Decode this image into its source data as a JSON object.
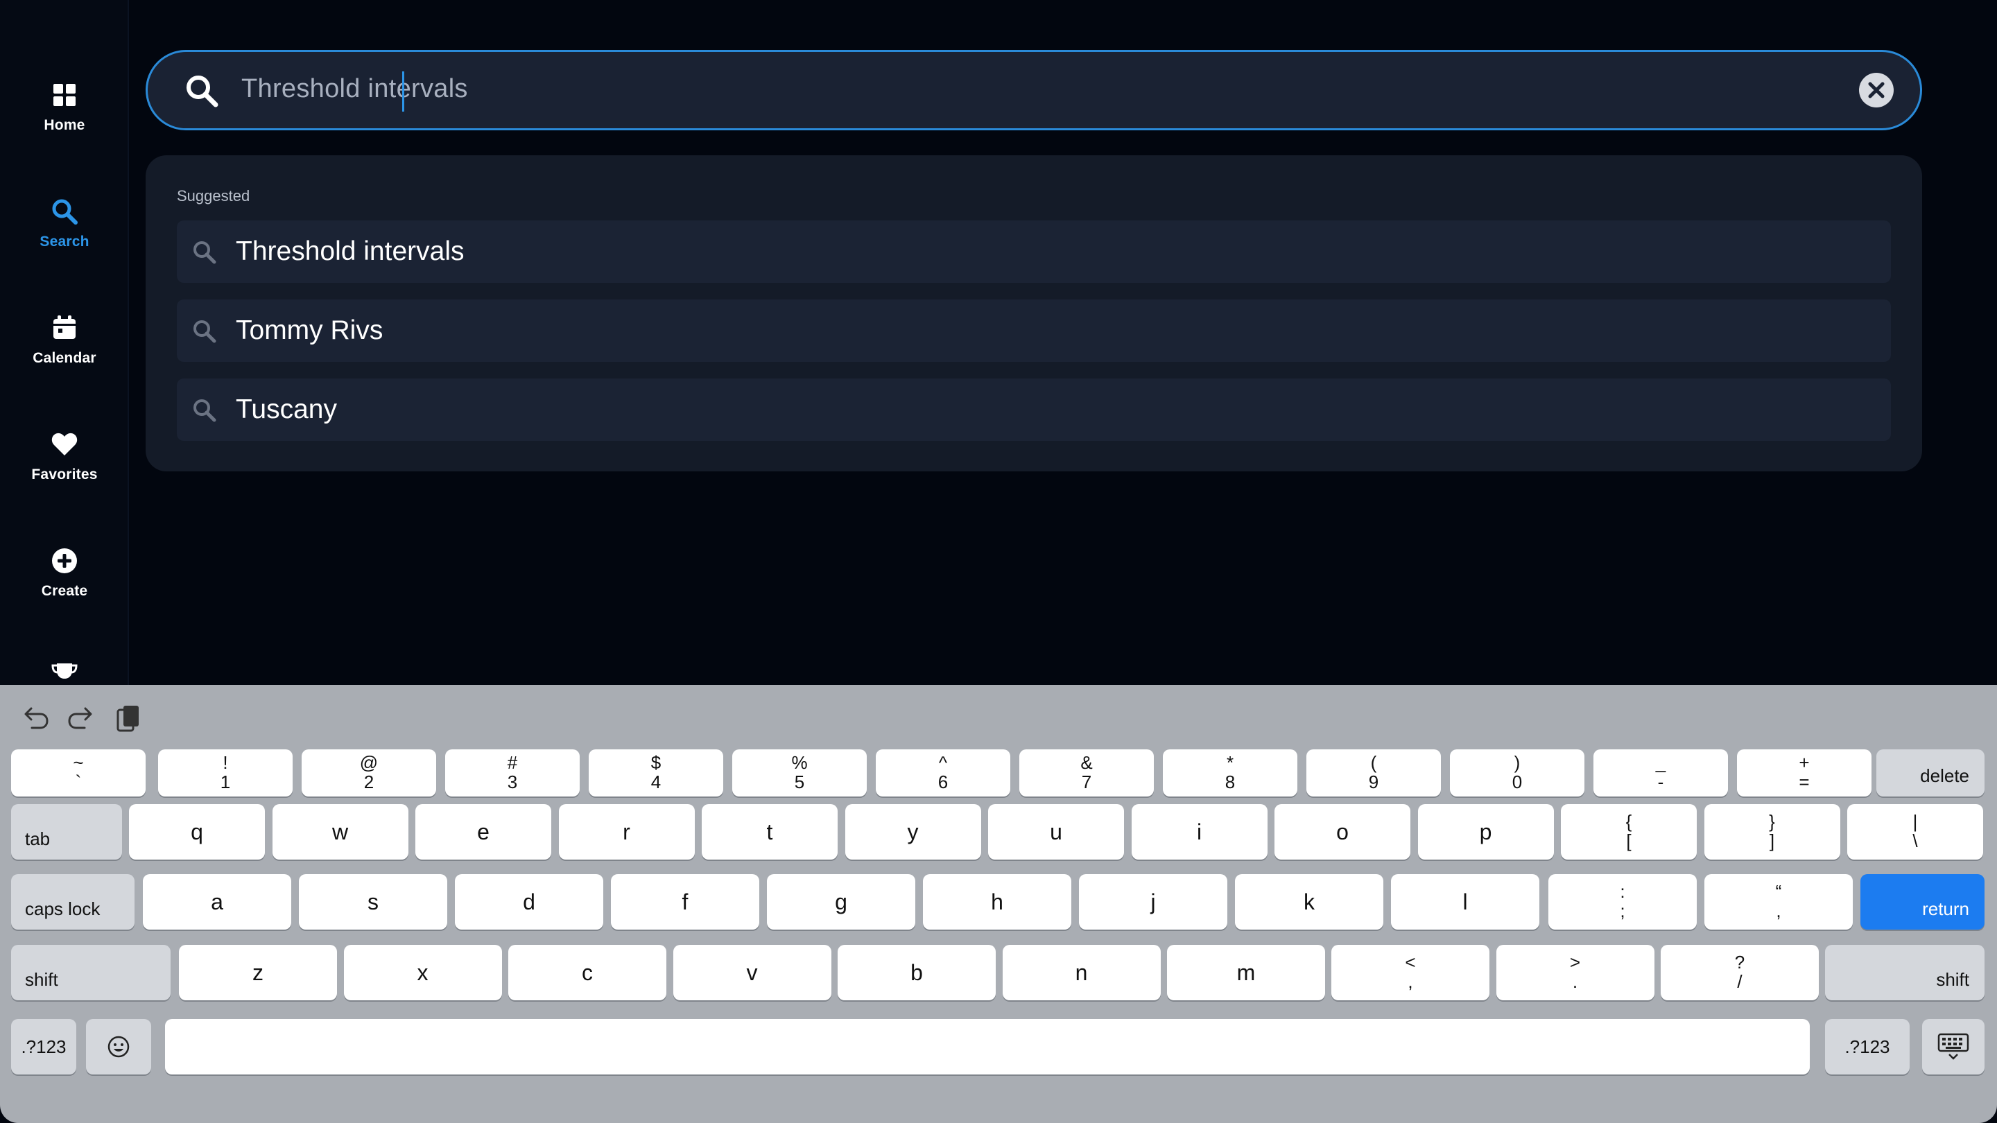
{
  "sidebar": {
    "items": [
      {
        "label": "Home",
        "icon": "grid-icon"
      },
      {
        "label": "Search",
        "icon": "search-icon"
      },
      {
        "label": "Calendar",
        "icon": "calendar-icon"
      },
      {
        "label": "Favorites",
        "icon": "heart-icon"
      },
      {
        "label": "Create",
        "icon": "plus-circle-icon"
      },
      {
        "label": "",
        "icon": "trophy-icon"
      }
    ],
    "active": "Search"
  },
  "search": {
    "value": "Threshold intervals",
    "clear_icon": "close-icon"
  },
  "suggestions": {
    "heading": "Suggested",
    "items": [
      "Threshold intervals",
      "Tommy Rivs",
      "Tuscany"
    ]
  },
  "keyboard": {
    "toolbar": [
      "undo-icon",
      "redo-icon",
      "paste-icon"
    ],
    "row1": [
      {
        "top": "~",
        "bottom": "`"
      },
      {
        "top": "!",
        "bottom": "1"
      },
      {
        "top": "@",
        "bottom": "2"
      },
      {
        "top": "#",
        "bottom": "3"
      },
      {
        "top": "$",
        "bottom": "4"
      },
      {
        "top": "%",
        "bottom": "5"
      },
      {
        "top": "^",
        "bottom": "6"
      },
      {
        "top": "&",
        "bottom": "7"
      },
      {
        "top": "*",
        "bottom": "8"
      },
      {
        "top": "(",
        "bottom": "9"
      },
      {
        "top": ")",
        "bottom": "0"
      },
      {
        "top": "_",
        "bottom": "-"
      },
      {
        "top": "+",
        "bottom": "="
      }
    ],
    "delete": "delete",
    "tab": "tab",
    "row2": [
      "q",
      "w",
      "e",
      "r",
      "t",
      "y",
      "u",
      "i",
      "o",
      "p"
    ],
    "row2_sym": [
      {
        "top": "{",
        "bottom": "["
      },
      {
        "top": "}",
        "bottom": "]"
      },
      {
        "top": "|",
        "bottom": "\\"
      }
    ],
    "caps": "caps lock",
    "row3": [
      "a",
      "s",
      "d",
      "f",
      "g",
      "h",
      "j",
      "k",
      "l"
    ],
    "row3_sym": [
      {
        "top": ":",
        "bottom": ";"
      },
      {
        "top": "“",
        "bottom": ","
      }
    ],
    "return": "return",
    "shift": "shift",
    "row4": [
      "z",
      "x",
      "c",
      "v",
      "b",
      "n",
      "m"
    ],
    "row4_sym": [
      {
        "top": "<",
        "bottom": ","
      },
      {
        "top": ">",
        "bottom": "."
      },
      {
        "top": "?",
        "bottom": "/"
      }
    ],
    "numbers": ".?123",
    "emoji_icon": "emoji-icon",
    "hide_icon": "keyboard-hide-icon"
  }
}
